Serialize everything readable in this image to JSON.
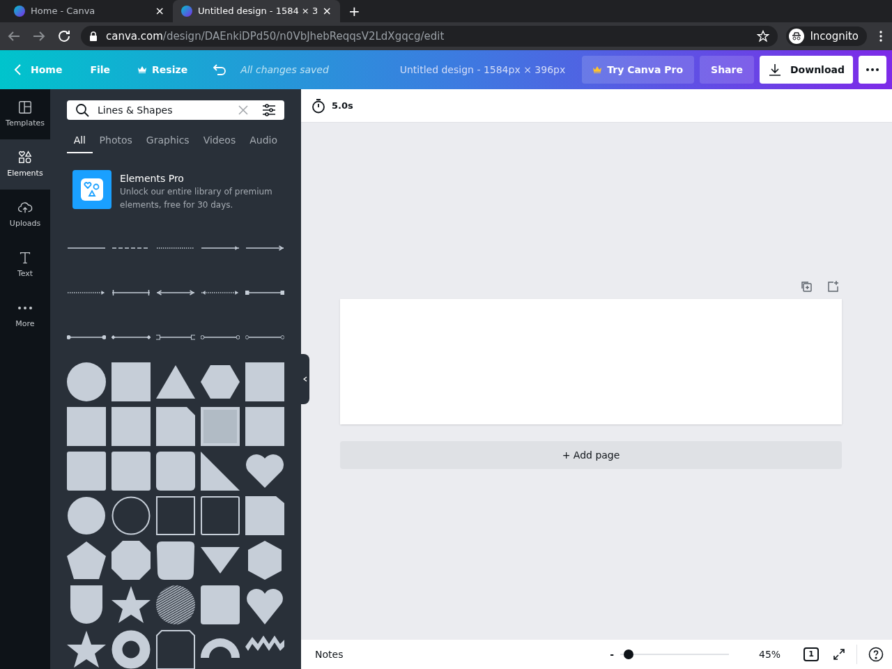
{
  "browser": {
    "tabs": [
      {
        "title": "Home - Canva",
        "selected": false,
        "close": "×"
      },
      {
        "title": "Untitled design - 1584 × 3",
        "selected": true,
        "close": "×"
      }
    ],
    "new_tab": "+",
    "url_host": "canva.com",
    "url_path": "/design/DAEnkiDPd50/n0VbJhebReqqsV2LdXgqcg/edit",
    "profile": "Incognito"
  },
  "header": {
    "home": "Home",
    "file": "File",
    "resize": "Resize",
    "save_status": "All changes saved",
    "design_title": "Untitled design - 1584px × 396px",
    "try_pro": "Try Canva Pro",
    "share": "Share",
    "download": "Download"
  },
  "rail": [
    {
      "label": "Templates",
      "selected": false,
      "kind": "templates"
    },
    {
      "label": "Elements",
      "selected": true,
      "kind": "elements"
    },
    {
      "label": "Uploads",
      "selected": false,
      "kind": "uploads"
    },
    {
      "label": "Text",
      "selected": false,
      "kind": "text"
    },
    {
      "label": "More",
      "selected": false,
      "kind": "more"
    }
  ],
  "panel": {
    "search": {
      "value": "Lines & Shapes"
    },
    "tabs": [
      {
        "label": "All",
        "selected": true
      },
      {
        "label": "Photos",
        "selected": false
      },
      {
        "label": "Graphics",
        "selected": false
      },
      {
        "label": "Videos",
        "selected": false
      },
      {
        "label": "Audio",
        "selected": false
      }
    ],
    "promo": {
      "title": "Elements Pro",
      "text": "Unlock our entire library of premium elements, free for 30 days."
    }
  },
  "toolbar": {
    "duration": "5.0s"
  },
  "canvas": {
    "add_page": "+ Add page"
  },
  "footer": {
    "notes": "Notes",
    "zoom_minus": "-",
    "zoom": {
      "level": 0.08
    },
    "zoom_reading": "45%",
    "page_count": "1"
  }
}
